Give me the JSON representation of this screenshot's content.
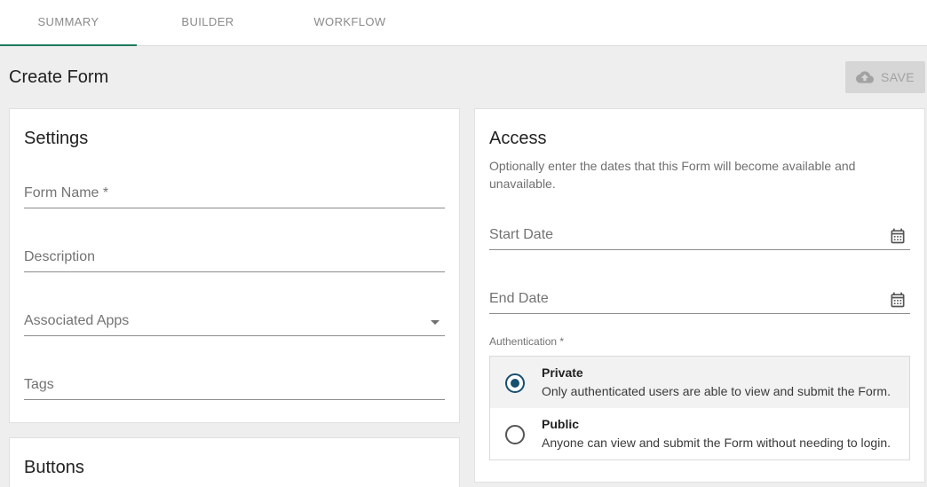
{
  "tabs": [
    {
      "label": "SUMMARY",
      "active": true
    },
    {
      "label": "BUILDER",
      "active": false
    },
    {
      "label": "WORKFLOW",
      "active": false
    }
  ],
  "colors": {
    "accent": "#1b7a5e",
    "radio_selected": "#174f70",
    "background": "#eeeeee",
    "save_disabled_bg": "#d6d6d6"
  },
  "page": {
    "title": "Create Form",
    "save_label": "SAVE",
    "save_icon": "cloud-upload-icon"
  },
  "settings": {
    "title": "Settings",
    "form_name": {
      "label": "Form Name *",
      "value": ""
    },
    "description": {
      "label": "Description",
      "value": ""
    },
    "associated_apps": {
      "label": "Associated Apps",
      "value": "",
      "icon": "dropdown-arrow-icon"
    },
    "tags": {
      "label": "Tags",
      "value": ""
    }
  },
  "buttons_section": {
    "title": "Buttons"
  },
  "access": {
    "title": "Access",
    "help": "Optionally enter the dates that this Form will become available and unavailable.",
    "start_date": {
      "label": "Start Date",
      "value": "",
      "icon": "calendar-icon"
    },
    "end_date": {
      "label": "End Date",
      "value": "",
      "icon": "calendar-icon"
    },
    "auth_label": "Authentication *",
    "options": [
      {
        "title": "Private",
        "description": "Only authenticated users are able to view and submit the Form.",
        "selected": true
      },
      {
        "title": "Public",
        "description": "Anyone can view and submit the Form without needing to login.",
        "selected": false
      }
    ]
  }
}
